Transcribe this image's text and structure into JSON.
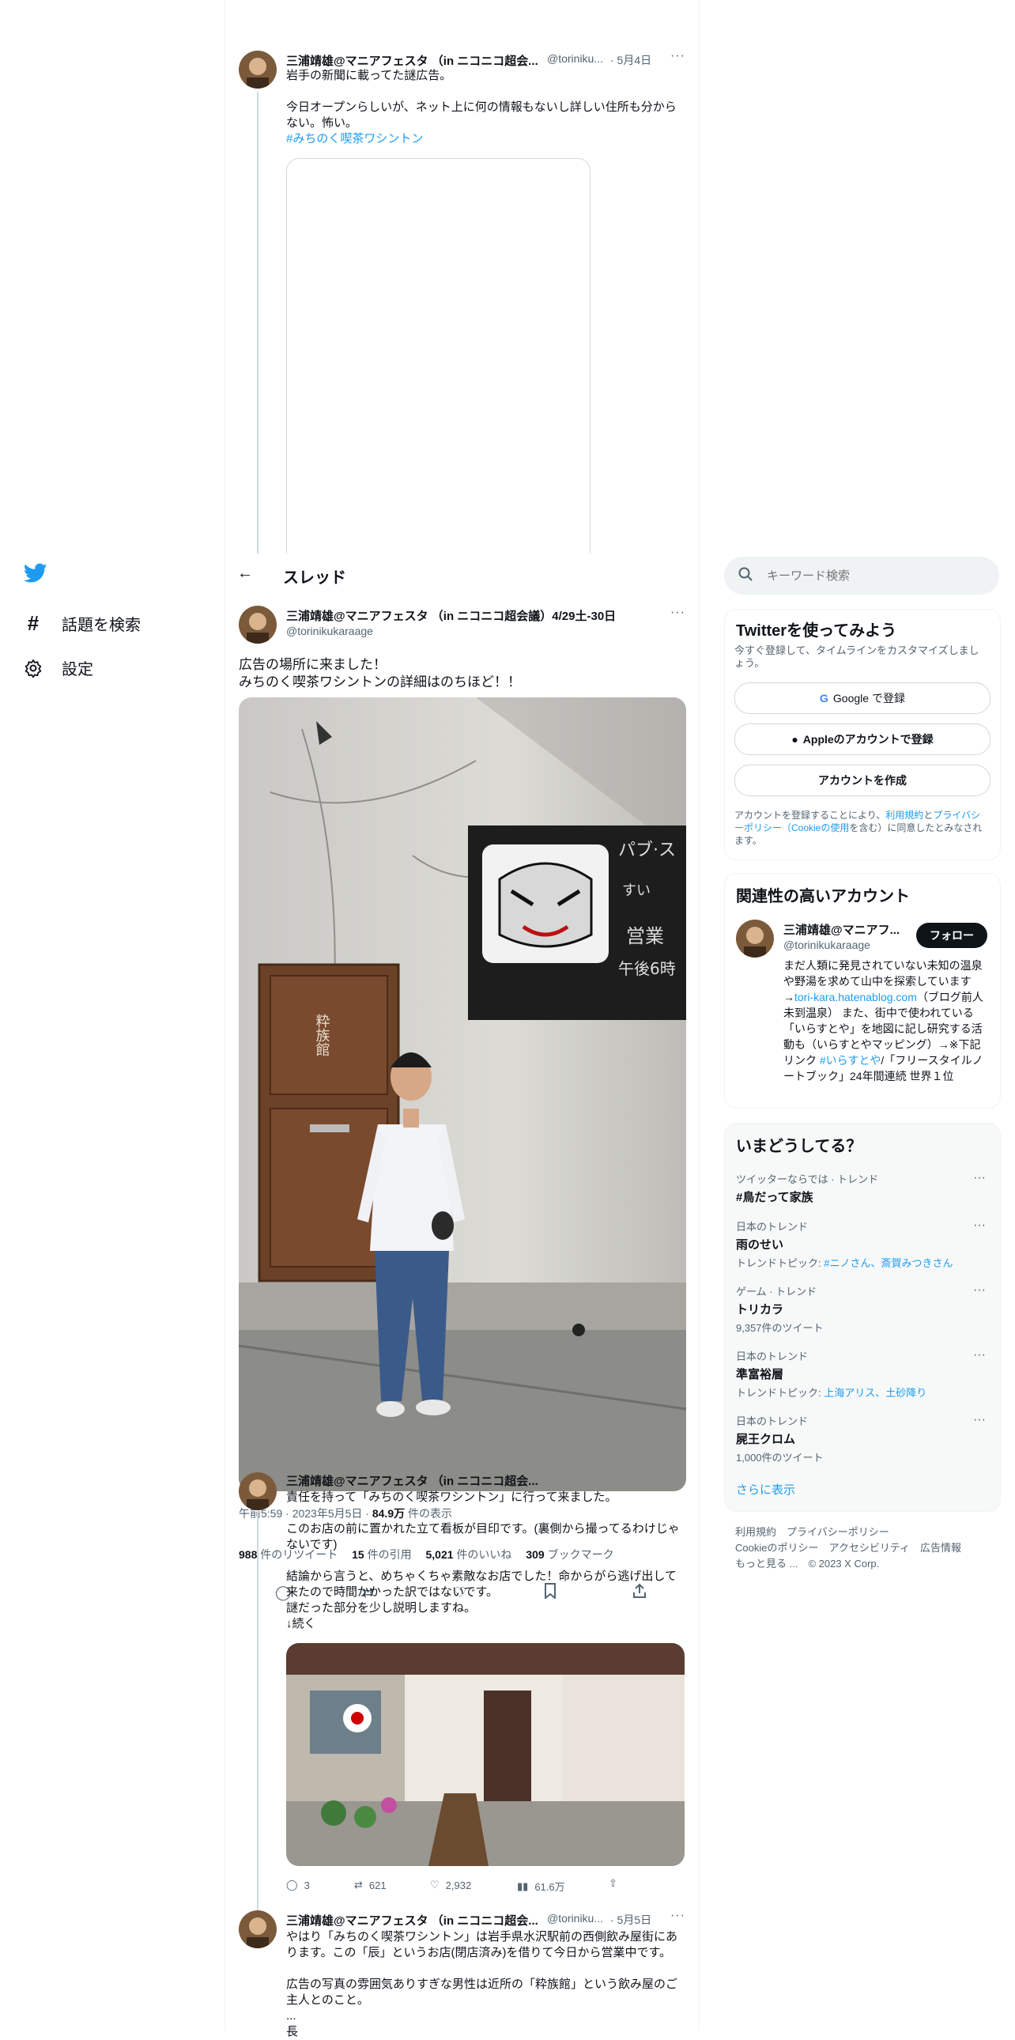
{
  "nav": {
    "explore_label": "話題を検索",
    "settings_label": "設定"
  },
  "header": {
    "back_icon": "arrow-left-icon",
    "title": "スレッド"
  },
  "search": {
    "placeholder": "キーワード検索"
  },
  "top_tweet": {
    "name": "三浦靖雄@マニアフェスタ （in ニコニコ超会...",
    "handle": "@toriniku...",
    "date": "· 5月4日",
    "text": "岩手の新聞に載ってた謎広告。\n\n今日オープンらしいが、ネット上に何の情報もないし詳しい住所も分からない。怖い。",
    "hashtag": "#みちのく喫茶ワシントン"
  },
  "main_tweet": {
    "name": "三浦靖雄@マニアフェスタ （in ニコニコ超会議）4/29土-30日",
    "handle": "@torinikukaraage",
    "text": "広告の場所に来ました！\nみちのく喫茶ワシントンの詳細はのちほど！！",
    "image_sign_text": "粋族館",
    "timestamp": "午前5:59 · 2023年5月5日 · ",
    "views_num": "84.9万",
    "views_label": " 件の表示",
    "retweets_num": "988",
    "retweets_label": " 件のリツイート",
    "quotes_num": "15",
    "quotes_label": " 件の引用",
    "likes_num": "5,021",
    "likes_label": " 件のいいね",
    "bookmarks_num": "309",
    "bookmarks_label": " ブックマーク"
  },
  "reply1": {
    "name": "三浦靖雄@マニアフェスタ （in ニコニコ超会...",
    "text": "責任を持って「みちのく喫茶ワシントン」に行って来ました。\n\nこのお店の前に置かれた立て看板が目印です。(裏側から撮ってるわけじゃないです)\n\n結論から言うと、めちゃくちゃ素敵なお店でした！命からがら逃げ出して来たので時間かかった訳ではないです。\n謎だった部分を少し説明しますね。\n↓続く",
    "replies": "3",
    "retweets": "621",
    "likes": "2,932",
    "views": "61.6万"
  },
  "reply2": {
    "name": "三浦靖雄@マニアフェスタ （in ニコニコ超会...",
    "handle": "@toriniku...",
    "date": "· 5月5日",
    "text": "やはり「みちのく喫茶ワシントン」は岩手県水沢駅前の西側飲み屋街にあります。この「辰」というお店(閉店済み)を借りて今日から営業中です。\n\n広告の写真の雰囲気ありすぎな男性は近所の「粋族館」という飲み屋のご主人とのこと。\n...\n長"
  },
  "signup": {
    "title": "Twitterを使ってみよう",
    "desc": "今すぐ登録して、タイムラインをカスタマイズしましょう。",
    "google": "Google で登録",
    "apple": "Appleのアカウントで登録",
    "create": "アカウントを作成",
    "terms_pre": "アカウントを登録することにより、",
    "terms_link1": "利用規約",
    "terms_mid": "と",
    "terms_link2": "プライバシーポリシー（Cookieの使用",
    "terms_post": "を含む）に同意したとみなされます。"
  },
  "related": {
    "title": "関連性の高いアカウント",
    "name": "三浦靖雄@マニアフ...",
    "handle": "@torinikukaraage",
    "follow": "フォロー",
    "bio_1": "まだ人類に発見されていない未知の温泉や野湯を求めて山中を探索しています→",
    "bio_link": "tori-kara.hatenablog.com",
    "bio_2": "（ブログ前人未到温泉） また、街中で使われている「いらすとや」を地図に記し研究する活動も（いらすとやマッピング）→※下記リンク ",
    "bio_tag": "#いらすとや",
    "bio_3": "/「フリースタイルノートブック」24年間連続 世界１位"
  },
  "trends": {
    "title": "いまどうしてる？",
    "items": [
      {
        "cat": "ツイッターならでは · トレンド",
        "title": "#鳥だって家族",
        "meta": "",
        "meta_link": ""
      },
      {
        "cat": "日本のトレンド",
        "title": "雨のせい",
        "meta": "トレンドトピック: ",
        "meta_link": "#ニノさん、斎賀みつきさん"
      },
      {
        "cat": "ゲーム · トレンド",
        "title": "トリカラ",
        "meta": "9,357件のツイート",
        "meta_link": ""
      },
      {
        "cat": "日本のトレンド",
        "title": "準富裕層",
        "meta": "トレンドトピック: ",
        "meta_link": "上海アリス、土砂降り"
      },
      {
        "cat": "日本のトレンド",
        "title": "屍王クロム",
        "meta": "1,000件のツイート",
        "meta_link": ""
      }
    ],
    "more": "さらに表示"
  },
  "footer": {
    "line1": "利用規約　プライバシーポリシー",
    "line2": "Cookieのポリシー　アクセシビリティ　広告情報",
    "line3": "もっと見る ...　© 2023 X Corp."
  },
  "colors": {
    "accent": "#1d9bf0",
    "text": "#0f1419",
    "muted": "#536471",
    "border": "#eff3f4"
  }
}
